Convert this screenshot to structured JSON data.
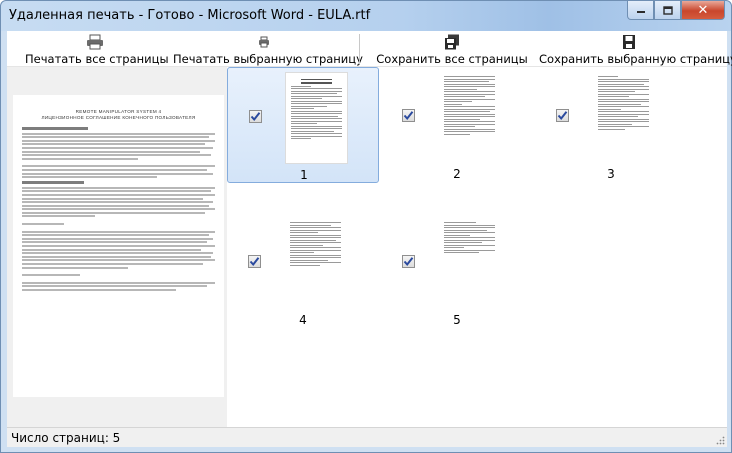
{
  "window": {
    "title": "Удаленная печать - Готово - Microsoft Word - EULA.rtf",
    "minimize_icon": "minimize-icon",
    "maximize_icon": "maximize-icon",
    "close_glyph": "✕"
  },
  "toolbar": {
    "print_all_label": "Печатать все страницы",
    "print_selected_label": "Печатать выбранную страницу",
    "save_all_label": "Сохранить все страницы",
    "save_selected_label": "Сохранить выбранную страницу"
  },
  "preview": {
    "heading_line1": "REMOTE MANIPULATOR SYSTEM 4",
    "heading_line2": "ЛИЦЕНЗИОННОЕ СОГЛАШЕНИЕ КОНЕЧНОГО ПОЛЬЗОВАТЕЛЯ"
  },
  "pages": [
    {
      "number": "1",
      "checked": true,
      "selected": true
    },
    {
      "number": "2",
      "checked": true,
      "selected": false
    },
    {
      "number": "3",
      "checked": true,
      "selected": false
    },
    {
      "number": "4",
      "checked": true,
      "selected": false
    },
    {
      "number": "5",
      "checked": true,
      "selected": false
    }
  ],
  "status": {
    "page_count_text": "Число страниц: 5"
  },
  "colors": {
    "selection_border": "#84acdd",
    "titlebar": "#b5d0ee",
    "close_button": "#c9462c"
  }
}
